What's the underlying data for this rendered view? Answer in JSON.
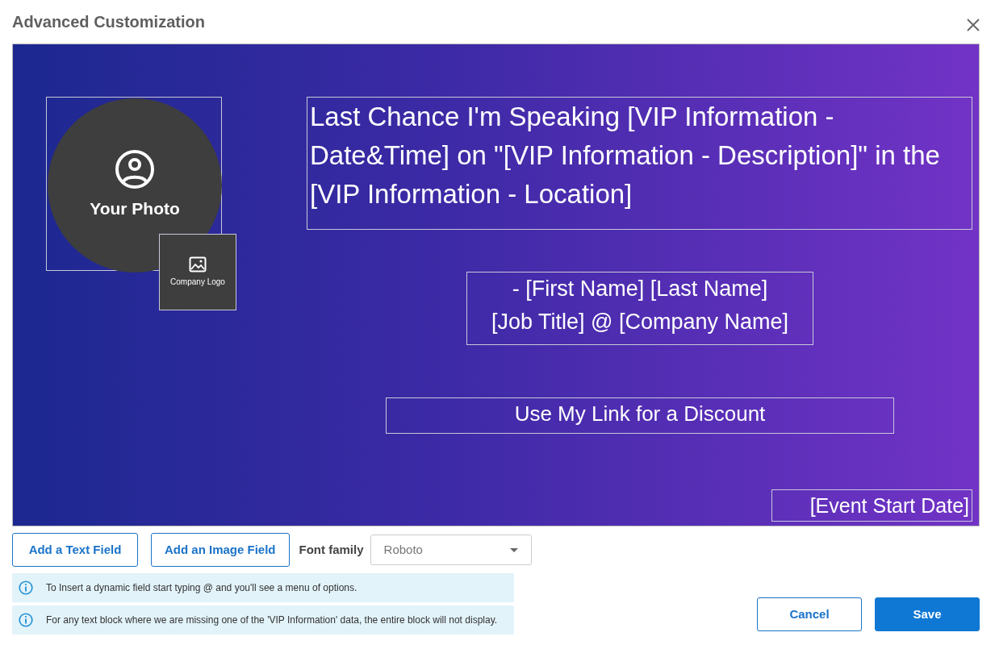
{
  "dialog": {
    "title": "Advanced Customization"
  },
  "canvas": {
    "photo": {
      "label": "Your Photo"
    },
    "logo": {
      "label": "Company Logo"
    },
    "text_fields": [
      {
        "kind": "headline",
        "text": "Last Chance I'm Speaking [VIP Information - Date&Time] on \"[VIP Information - Description]\" in the [VIP Information - Location]"
      },
      {
        "kind": "name",
        "text": "- [First Name] [Last Name]\n[Job Title] @ [Company Name]"
      },
      {
        "kind": "link",
        "text": "Use My Link for a Discount"
      },
      {
        "kind": "date",
        "text": "[Event Start Date]"
      }
    ]
  },
  "toolbar": {
    "buttons": [
      "Add a Text Field",
      "Add an Image Field"
    ],
    "font_family": {
      "label": "Font family",
      "value": "Roboto"
    }
  },
  "notices": [
    "To Insert a dynamic field start typing @ and you'll see a menu of options.",
    "For any text block where we are missing one of the 'VIP Information' data, the entire block will not display."
  ],
  "actions": [
    {
      "kind": "secondary",
      "label": "Cancel"
    },
    {
      "kind": "primary",
      "label": "Save"
    }
  ]
}
